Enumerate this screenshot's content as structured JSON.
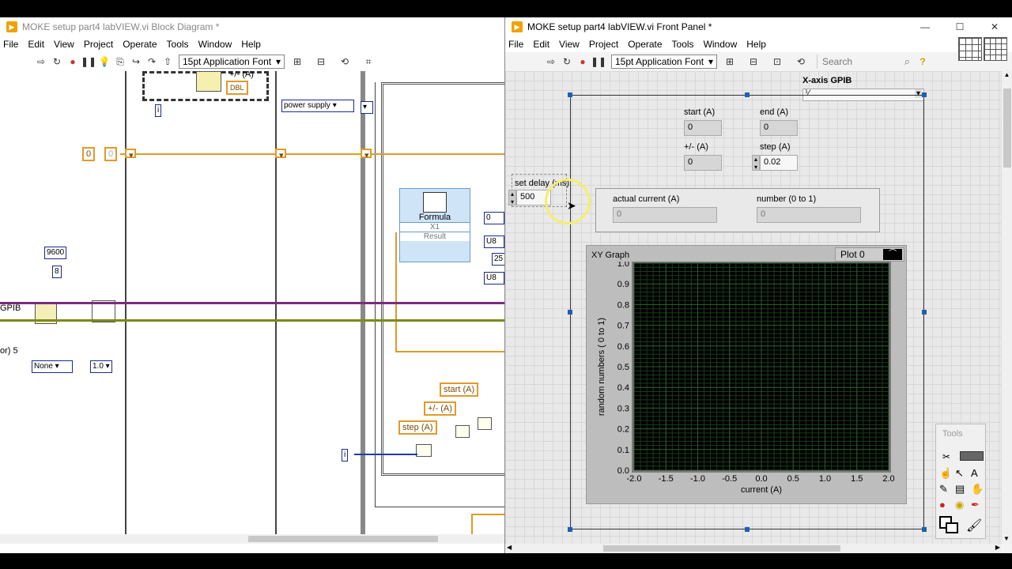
{
  "block_diagram": {
    "title": "MOKE setup part4 labVIEW.vi Block Diagram *",
    "menu": [
      "File",
      "Edit",
      "View",
      "Project",
      "Operate",
      "Tools",
      "Window",
      "Help"
    ],
    "font": "15pt Application Font",
    "consts": {
      "zero_a": "0",
      "zero_b": "0",
      "baud": "9600",
      "bits": "8",
      "none": "None",
      "one": "1.0",
      "power_supply": "power supply",
      "zero_c": "0",
      "twenty_five": "25",
      "gpib": "GPIB",
      "or5": "or) 5",
      "plus_minus": "+/- (A)",
      "dbl": "DBL"
    },
    "formula": {
      "title": "Formula",
      "input": "X1",
      "output": "Result"
    },
    "locals": {
      "start": "start (A)",
      "pm": "+/- (A)",
      "step": "step (A)"
    },
    "u8": "U8",
    "iter": "i"
  },
  "front_panel": {
    "title": "MOKE setup part4 labVIEW.vi Front Panel *",
    "menu": [
      "File",
      "Edit",
      "View",
      "Project",
      "Operate",
      "Tools",
      "Window",
      "Help"
    ],
    "font": "15pt Application Font",
    "search_placeholder": "Search",
    "xaxis_label": "X-axis GPIB",
    "controls": {
      "start_label": "start (A)",
      "start_value": "0",
      "end_label": "end (A)",
      "end_value": "0",
      "pm_label": "+/- (A)",
      "pm_value": "0",
      "step_label": "step (A)",
      "step_value": "0.02",
      "delay_label": "set delay (ms)",
      "delay_value": "500",
      "current_label": "actual current (A)",
      "current_value": "0",
      "number_label": "number (0 to 1)",
      "number_value": "0"
    },
    "graph": {
      "title": "XY Graph",
      "plot_legend": "Plot 0"
    },
    "tools_palette": {
      "title": "Tools"
    }
  },
  "chart_data": {
    "type": "scatter",
    "title": "XY Graph",
    "xlabel": "current (A)",
    "ylabel": "random numbers ( 0 to 1)",
    "xlim": [
      -2.0,
      2.0
    ],
    "ylim": [
      0.0,
      1.0
    ],
    "x_ticks": [
      "-2.0",
      "-1.5",
      "-1.0",
      "-0.5",
      "0.0",
      "0.5",
      "1.0",
      "1.5",
      "2.0"
    ],
    "y_ticks": [
      "0.0",
      "0.1",
      "0.2",
      "0.3",
      "0.4",
      "0.5",
      "0.6",
      "0.7",
      "0.8",
      "0.9",
      "1.0"
    ],
    "series": [
      {
        "name": "Plot 0",
        "x": [],
        "y": []
      }
    ],
    "grid": true,
    "legend": "top-right"
  },
  "colors": {
    "labview_orange": "#f1a100",
    "wire_orange": "#e09a2b",
    "wire_purple": "#7b2b7e",
    "wire_olive": "#7b8a1b",
    "graph_bg": "#000000",
    "graph_grid": "#2d5a2d"
  }
}
